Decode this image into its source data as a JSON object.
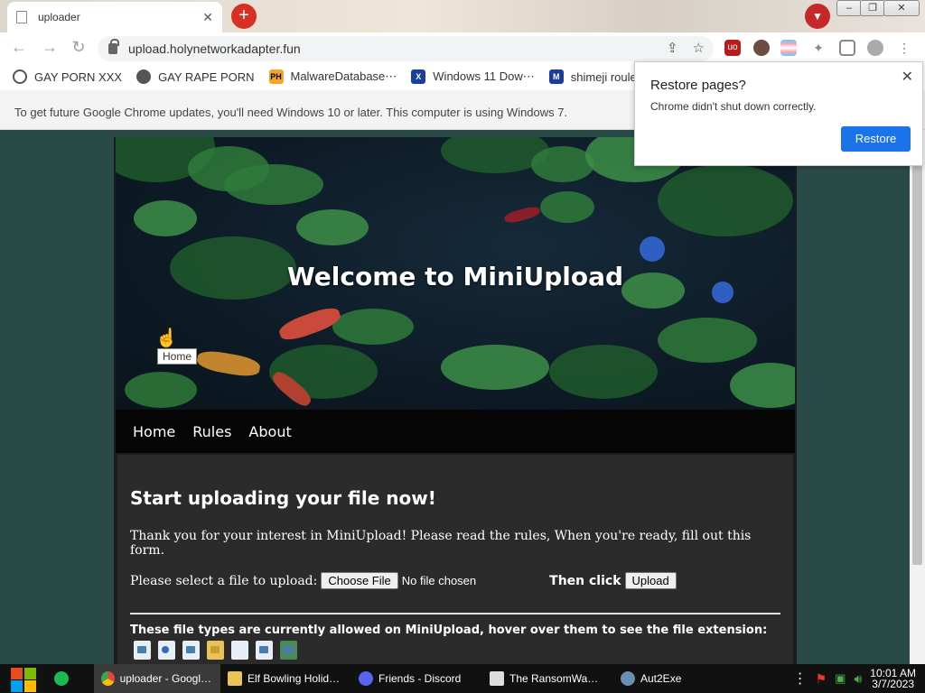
{
  "browser": {
    "tab_title": "uploader",
    "url": "upload.holynetworkadapter.fun",
    "bookmarks": [
      {
        "label": "GAY PORN XXX"
      },
      {
        "label": "GAY RAPE PORN"
      },
      {
        "label": "MalwareDatabase⋯"
      },
      {
        "label": "Windows 11 Dow⋯"
      },
      {
        "label": "shimeji roulette"
      }
    ],
    "infobar_text": "To get future Google Chrome updates, you'll need Windows 10 or later. This computer is using Windows 7."
  },
  "popup": {
    "title": "Restore pages?",
    "message": "Chrome didn't shut down correctly.",
    "restore_label": "Restore"
  },
  "page": {
    "hero_title": "Welcome to MiniUpload",
    "tooltip": "Home",
    "nav": [
      {
        "label": "Home"
      },
      {
        "label": "Rules"
      },
      {
        "label": "About"
      }
    ],
    "heading": "Start uploading your file now!",
    "intro": "Thank you for your interest in MiniUpload! Please read the rules, When you're ready, fill out this form.",
    "select_label": "Please select a file to upload:",
    "choose_file_label": "Choose File",
    "no_file_text": "No file chosen",
    "then_click": "Then click",
    "upload_label": "Upload",
    "file_types_text": "These file types are currently allowed on MiniUpload, hover over them to see the file extension:",
    "file_type_icons": [
      "document-icon",
      "music-icon",
      "video-icon",
      "folder-icon",
      "blank-file-icon",
      "text-file-icon",
      "image-icon"
    ]
  },
  "taskbar": {
    "items": [
      {
        "label": "uploader - Googl…",
        "icon": "chrome-icon",
        "active": true
      },
      {
        "label": "Elf Bowling Holid…",
        "icon": "folder-icon"
      },
      {
        "label": "Friends - Discord",
        "icon": "discord-icon"
      },
      {
        "label": "The RansomWa…",
        "icon": "window-icon"
      },
      {
        "label": "Aut2Exe",
        "icon": "autoit-icon"
      }
    ],
    "time": "10:01 AM",
    "date": "3/7/2023"
  }
}
